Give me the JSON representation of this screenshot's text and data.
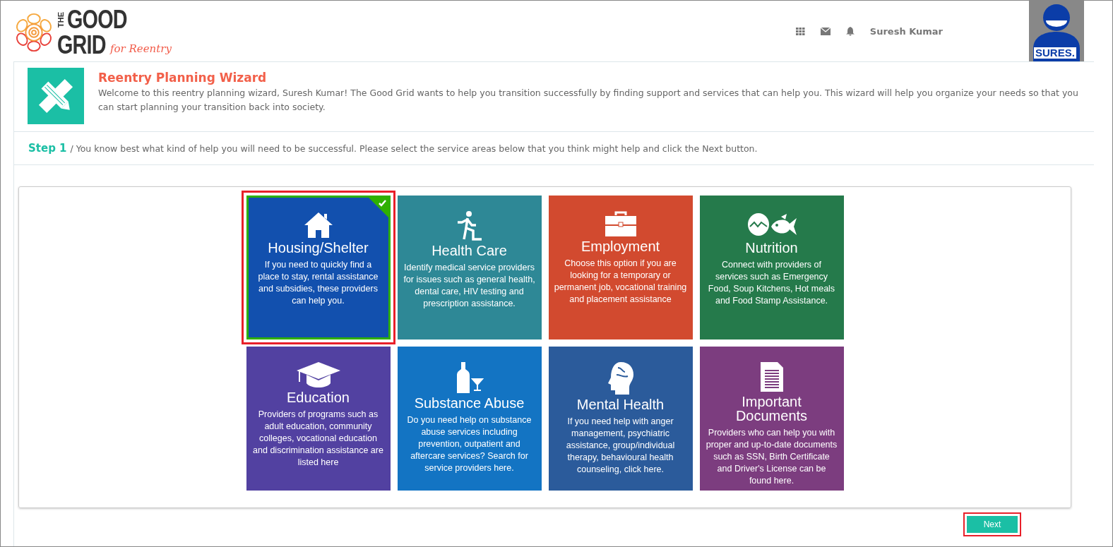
{
  "logo": {
    "the": "THE",
    "good": "GOOD",
    "grid": "GRID",
    "tagline": "for Reentry"
  },
  "header": {
    "user_name": "Suresh Kumar",
    "avatar_label": "SURES."
  },
  "wizard": {
    "title": "Reentry Planning Wizard",
    "intro": "Welcome to this reentry planning wizard, Suresh Kumar! The Good Grid wants to help you transition successfully by finding support and services that can help you. This wizard will help you organize your needs so that you can start planning your transition back into society.",
    "step_label": "Step 1",
    "step_text": "/ You know best what kind of help you will need to be successful. Please select the service areas below that you think might help and click the Next button."
  },
  "services": [
    {
      "kind": "house",
      "title": "Housing/Shelter",
      "description": "If you need to quickly find a place to stay, rental assistance and subsidies, these providers can help you.",
      "color": "#1250ae",
      "selected": true
    },
    {
      "kind": "runner",
      "title": "Health Care",
      "description": "Identify medical service providers for issues such as general health, dental care, HIV testing and prescription assistance.",
      "color": "#2e8896",
      "selected": false
    },
    {
      "kind": "briefcase",
      "title": "Employment",
      "description": "Choose this option if you are looking for a temporary or permanent job, vocational training and placement assistance",
      "color": "#d24a2f",
      "selected": false
    },
    {
      "kind": "food",
      "title": "Nutrition",
      "description": "Connect with providers of services such as Emergency Food, Soup Kitchens, Hot meals and Food Stamp Assistance.",
      "color": "#257a4b",
      "selected": false
    },
    {
      "kind": "cap",
      "title": "Education",
      "description": "Providers of programs such as adult education, community colleges, vocational education and discrimination assistance are listed here",
      "color": "#5241a1",
      "selected": false
    },
    {
      "kind": "bottle",
      "title": "Substance Abuse",
      "description": "Do you need help on substance abuse services including prevention, outpatient and aftercare services? Search for service providers here.",
      "color": "#1374c3",
      "selected": false
    },
    {
      "kind": "head",
      "title": "Mental Health",
      "description": "If you need help with anger management, psychiatric assistance, group/individual therapy, behavioural health counseling, click here.",
      "color": "#2b5b9b",
      "selected": false
    },
    {
      "kind": "document",
      "title": "Important Documents",
      "description": "Providers who can help you with proper and up-to-date documents such as SSN, Birth Certificate and Driver's License can be found here.",
      "color": "#7c3d7f",
      "selected": false
    }
  ],
  "next_button": "Next"
}
